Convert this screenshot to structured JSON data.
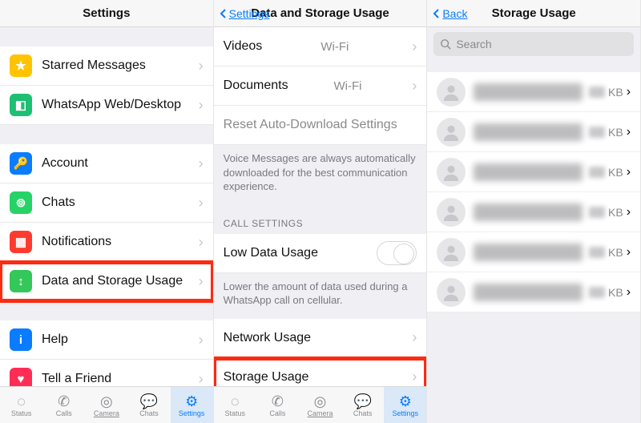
{
  "p1": {
    "title": "Settings",
    "grp1": [
      {
        "label": "Starred Messages",
        "name": "starred-messages",
        "color": "#ffc300",
        "glyph": "★"
      },
      {
        "label": "WhatsApp Web/Desktop",
        "name": "whatsapp-web",
        "color": "#1dbf73",
        "glyph": "◧"
      }
    ],
    "grp2": [
      {
        "label": "Account",
        "name": "account",
        "color": "#0a7cff",
        "glyph": "🔑"
      },
      {
        "label": "Chats",
        "name": "chats",
        "color": "#25d366",
        "glyph": "⊚"
      },
      {
        "label": "Notifications",
        "name": "notifications",
        "color": "#ff3b30",
        "glyph": "▦"
      },
      {
        "label": "Data and Storage Usage",
        "name": "data-storage-usage",
        "color": "#34c759",
        "glyph": "↕",
        "hi": true
      }
    ],
    "grp3": [
      {
        "label": "Help",
        "name": "help",
        "color": "#0a7cff",
        "glyph": "i"
      },
      {
        "label": "Tell a Friend",
        "name": "tell-a-friend",
        "color": "#ff2d55",
        "glyph": "♥"
      }
    ]
  },
  "p2": {
    "back": "Settings",
    "title": "Data and Storage Usage",
    "rows1": [
      {
        "label": "Videos",
        "value": "Wi-Fi",
        "name": "videos"
      },
      {
        "label": "Documents",
        "value": "Wi-Fi",
        "name": "documents"
      }
    ],
    "reset": "Reset Auto-Download Settings",
    "voice_note": "Voice Messages are always automatically downloaded for the best communication experience.",
    "call_header": "CALL SETTINGS",
    "low_data": "Low Data Usage",
    "low_data_note": "Lower the amount of data used during a WhatsApp call on cellular.",
    "rows2": [
      {
        "label": "Network Usage",
        "name": "network-usage"
      },
      {
        "label": "Storage Usage",
        "name": "storage-usage",
        "hi": true
      }
    ]
  },
  "p3": {
    "back": "Back",
    "title": "Storage Usage",
    "search_ph": "Search",
    "unit": "KB",
    "contacts": [
      1,
      2,
      3,
      4,
      5,
      6
    ]
  },
  "tabs": [
    {
      "label": "Status",
      "name": "status",
      "glyph": "◌"
    },
    {
      "label": "Calls",
      "name": "calls",
      "glyph": "✆"
    },
    {
      "label": "Camera",
      "name": "camera",
      "glyph": "◎",
      "u": true
    },
    {
      "label": "Chats",
      "name": "chats",
      "glyph": "💬"
    },
    {
      "label": "Settings",
      "name": "settings",
      "glyph": "⚙",
      "act": true
    }
  ]
}
